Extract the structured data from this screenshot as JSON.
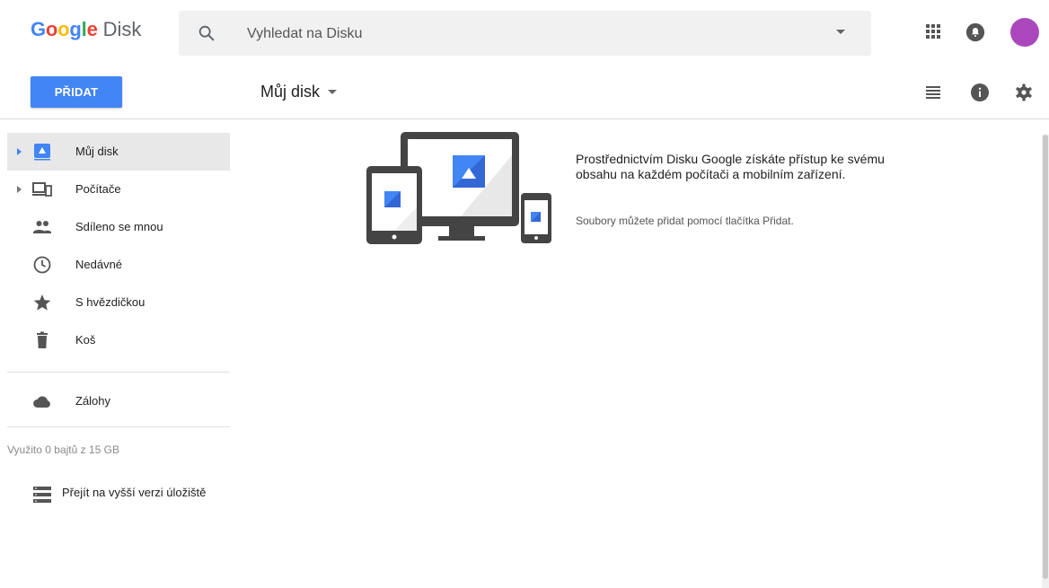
{
  "app": {
    "logo_google": "Google",
    "logo_product": "Disk",
    "brand_colors": [
      "#4285f4",
      "#ea4335",
      "#fbbc05",
      "#34a853"
    ]
  },
  "search": {
    "placeholder": "Vyhledat na Disku",
    "icon": "search-icon"
  },
  "header_icons": [
    "apps-grid-icon",
    "notifications-bell-icon",
    "avatar"
  ],
  "avatar_color": "#ab47bc",
  "toolbar": {
    "new_label": "PŘIDAT",
    "breadcrumb": "Můj disk",
    "icons": [
      "list-view-icon",
      "info-icon",
      "settings-gear-icon"
    ]
  },
  "sidebar": {
    "items": [
      {
        "label": "Můj disk",
        "icon": "drive-icon",
        "expandable": true,
        "active": true
      },
      {
        "label": "Počítače",
        "icon": "computers-icon",
        "expandable": true,
        "active": false
      },
      {
        "label": "Sdíleno se mnou",
        "icon": "shared-people-icon",
        "expandable": false,
        "active": false
      },
      {
        "label": "Nedávné",
        "icon": "clock-icon",
        "expandable": false,
        "active": false
      },
      {
        "label": "S hvězdičkou",
        "icon": "star-icon",
        "expandable": false,
        "active": false
      },
      {
        "label": "Koš",
        "icon": "trash-icon",
        "expandable": false,
        "active": false
      }
    ],
    "backups": {
      "label": "Zálohy",
      "icon": "cloud-icon"
    },
    "storage_text": "Využito 0 bajtů z 15 GB",
    "upgrade": {
      "label": "Přejít na vyšší verzi úložiště",
      "icon": "storage-icon"
    }
  },
  "empty_state": {
    "title": "Prostřednictvím Disku Google získáte přístup ke svému obsahu na každém počítači a mobilním zařízení.",
    "subtitle": "Soubory můžete přidat pomocí tlačítka Přidat.",
    "illustration": "devices-illustration"
  },
  "accent_color": "#4285f4"
}
